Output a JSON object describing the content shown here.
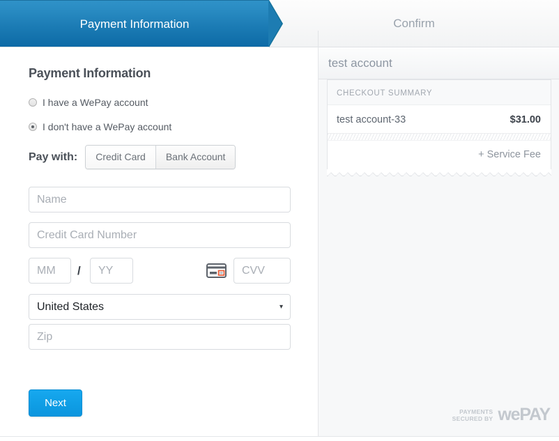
{
  "steps": [
    {
      "label": "Payment Information",
      "state": "active"
    },
    {
      "label": "Confirm",
      "state": "inactive"
    }
  ],
  "form": {
    "title": "Payment Information",
    "account_options": [
      {
        "label": "I have a WePay account",
        "selected": false
      },
      {
        "label": "I don't have a WePay account",
        "selected": true
      }
    ],
    "pay_with_label": "Pay with:",
    "pay_with_options": [
      {
        "label": "Credit Card",
        "selected": true
      },
      {
        "label": "Bank Account",
        "selected": false
      }
    ],
    "name_placeholder": "Name",
    "name_value": "",
    "card_number_placeholder": "Credit Card Number",
    "card_number_value": "",
    "exp_month_placeholder": "MM",
    "exp_month_value": "",
    "exp_separator": "/",
    "exp_year_placeholder": "YY",
    "exp_year_value": "",
    "cvv_placeholder": "CVV",
    "cvv_value": "",
    "cvv_icon": "credit-card-icon",
    "country_value": "United States",
    "country_caret": "▾",
    "zip_placeholder": "Zip",
    "zip_value": "",
    "next_label": "Next"
  },
  "summary": {
    "account_name": "test account",
    "heading": "CHECKOUT SUMMARY",
    "items": [
      {
        "name": "test account-33",
        "price": "$31.00"
      }
    ],
    "service_fee_label": "+ Service Fee"
  },
  "footer": {
    "secured_line1": "PAYMENTS",
    "secured_line2": "SECURED BY",
    "brand_part1": "we",
    "brand_part2": "PAY"
  },
  "colors": {
    "accent_blue": "#1d7cb2",
    "button_blue": "#109fe6",
    "panel_bg": "#f7f8f9",
    "text_dark": "#4b5159",
    "text_muted": "#8d96a2"
  }
}
